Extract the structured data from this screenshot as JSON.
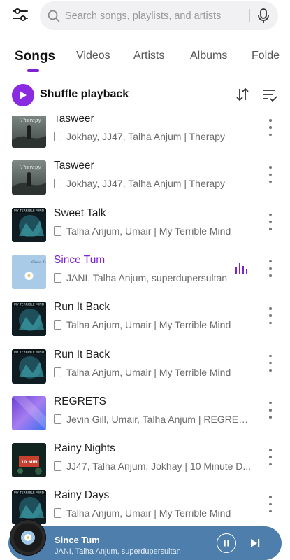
{
  "search": {
    "placeholder": "Search songs, playlists, and artists"
  },
  "tabs": [
    {
      "label": "Songs"
    },
    {
      "label": "Videos"
    },
    {
      "label": "Artists"
    },
    {
      "label": "Albums"
    },
    {
      "label": "Folde"
    }
  ],
  "shuffle": {
    "label": "Shuffle playback"
  },
  "songs": [
    {
      "title": "Tasweer",
      "subtitle": "Jokhay, JJ47, Talha Anjum | Therapy",
      "art": "therapy"
    },
    {
      "title": "Tasweer",
      "subtitle": "Jokhay, JJ47, Talha Anjum | Therapy",
      "art": "therapy"
    },
    {
      "title": "Sweet Talk",
      "subtitle": "Talha Anjum, Umair | My Terrible Mind",
      "art": "terrible"
    },
    {
      "title": "Since Tum",
      "subtitle": "JANI, Talha Anjum, superdupersultan",
      "art": "sincetum",
      "playing": true
    },
    {
      "title": "Run It Back",
      "subtitle": "Talha Anjum, Umair | My Terrible Mind",
      "art": "terrible"
    },
    {
      "title": "Run It Back",
      "subtitle": "Talha Anjum, Umair | My Terrible Mind",
      "art": "terrible"
    },
    {
      "title": "REGRETS",
      "subtitle": "Jevin Gill, Umair, Talha Anjum | REGRETS...",
      "art": "regrets"
    },
    {
      "title": "Rainy Nights",
      "subtitle": "JJ47, Talha Anjum, Jokhay | 10 Minute D...",
      "art": "rainy"
    },
    {
      "title": "Rainy Days",
      "subtitle": "Talha Anjum, Umair | My Terrible Mind",
      "art": "terrible"
    }
  ],
  "player": {
    "title": "Since Tum",
    "artists": "JANI, Talha Anjum, superdupersultan"
  },
  "colors": {
    "accent": "#7e22ce",
    "player_bg": "#4e7fac"
  }
}
